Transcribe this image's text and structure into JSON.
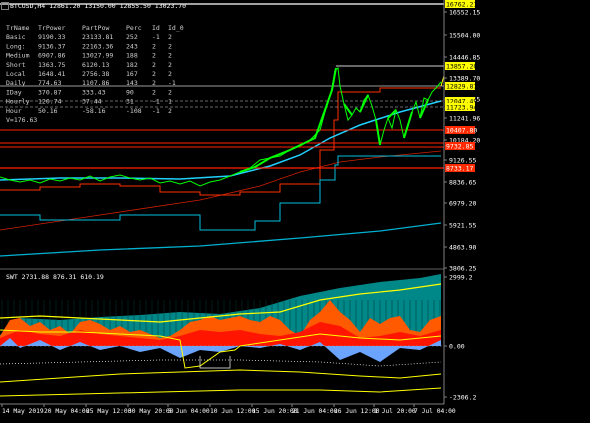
{
  "window": {
    "symbol_header": "BTCUSD,H4  12861.20 13150.00 12855.50 13023.70",
    "sub_header": "SWT 2731.88 876.31 610.19"
  },
  "info_table": {
    "columns": [
      "TrName",
      "TrPower",
      "PartPow",
      "Perc",
      "Id",
      "Id_0"
    ],
    "rows": [
      [
        "Basic",
        "9190.33",
        "23133.81",
        "252",
        "-1",
        "2"
      ],
      [
        "Long:",
        "9136.37",
        "22163.36",
        "243",
        "2",
        "2"
      ],
      [
        "Medium",
        "6907.86",
        "13027.99",
        "188",
        "2",
        "2"
      ],
      [
        "Short",
        "1363.75",
        "6120.13",
        "182",
        "2",
        "2"
      ],
      [
        "Local",
        "1648.41",
        "2756.38",
        "167",
        "2",
        "2"
      ],
      [
        "Daily",
        "774.63",
        "1107.86",
        "143",
        "2",
        "-1"
      ],
      [
        "IDay",
        "370.87",
        "333.43",
        "90",
        "2",
        "2"
      ],
      [
        "Hourly",
        "120.74",
        "37.44",
        "31",
        "-1",
        "1"
      ],
      [
        "Hour",
        "50.16",
        "-58.16",
        "-108",
        "-1",
        "2"
      ]
    ],
    "footer": "V=176.63"
  },
  "price_axis": {
    "ticks": [
      "16552.15",
      "15504.00",
      "14446.85",
      "13389.70",
      "12332.55",
      "11241.96",
      "10184.20",
      "9126.55",
      "8836.65",
      "6979.20",
      "5921.55",
      "4863.90",
      "3806.25"
    ],
    "labels": [
      {
        "text": "16762.21",
        "bg": "#ffff00",
        "fg": "#000000"
      },
      {
        "text": "13857.20",
        "bg": "#ffff00",
        "fg": "#000000"
      },
      {
        "text": "12829.87",
        "bg": "#ffff00",
        "fg": "#000000"
      },
      {
        "text": "12047.49",
        "bg": "#ffff00",
        "fg": "#000000"
      },
      {
        "text": "11723.94",
        "bg": "#ffff00",
        "fg": "#000000"
      },
      {
        "text": "10407.80",
        "bg": "#ff2a00",
        "fg": "#ffffff"
      },
      {
        "text": "9732.85",
        "bg": "#ff2a00",
        "fg": "#ffffff"
      },
      {
        "text": "8733.17",
        "bg": "#ff2a00",
        "fg": "#ffffff"
      }
    ]
  },
  "indicator_axis": {
    "ticks": [
      "2999.2",
      "0.00",
      "-2306.2"
    ]
  },
  "time_axis": {
    "ticks": [
      "14 May 2019",
      "20 May 04:00",
      "25 May 12:00",
      "30 May 20:00",
      "5 Jun 04:00",
      "10 Jun 12:00",
      "15 Jun 20:00",
      "21 Jun 04:00",
      "26 Jun 12:00",
      "1 Jul 20:00",
      "7 Jul 04:00"
    ]
  },
  "colors": {
    "background": "#000000",
    "price": "#00ff00",
    "cyan": "#00c0e0",
    "yellow": "#ffff00",
    "red": "#ff2000",
    "orange": "#ff6000",
    "teal": "#00a0a0",
    "blue_area": "#6aa4ff",
    "level_white": "#e0e0e0"
  }
}
